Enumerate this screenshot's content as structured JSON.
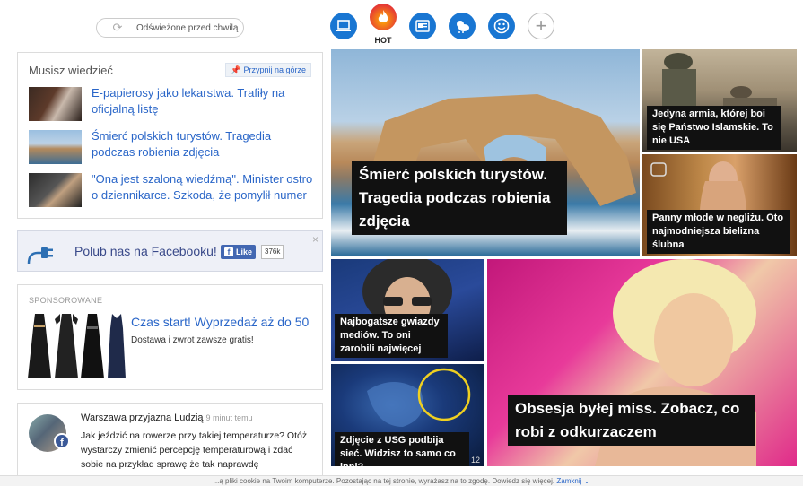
{
  "refresh": {
    "label": "Odświeżone przed chwilą",
    "icon": "refresh-icon"
  },
  "topnav": [
    {
      "id": "computer",
      "icon": "laptop-icon",
      "label": ""
    },
    {
      "id": "hot",
      "icon": "flame-icon",
      "label": "HOT"
    },
    {
      "id": "news",
      "icon": "news-icon",
      "label": ""
    },
    {
      "id": "weather",
      "icon": "weather-icon",
      "label": ""
    },
    {
      "id": "fun",
      "icon": "smiley-icon",
      "label": ""
    },
    {
      "id": "add",
      "icon": "plus-icon",
      "label": ""
    }
  ],
  "must_know": {
    "title": "Musisz wiedzieć",
    "pin_label": "Przypnij na górze",
    "items": [
      {
        "text": "E-papierosy jako lekarstwa. Trafiły na oficjalną listę"
      },
      {
        "text": "Śmierć polskich turystów. Tragedia podczas robienia zdjęcia"
      },
      {
        "text": "\"Ona jest szaloną wiedźmą\". Minister ostro o dziennikarce. Szkoda, że pomylił numer"
      }
    ]
  },
  "facebook": {
    "text": "Polub nas na Facebooku!",
    "like_label": "Like",
    "count": "376k"
  },
  "sponsored": {
    "label": "SPONSOROWANE",
    "title": "Czas start! Wyprzedaż aż do 50",
    "subtitle": "Dostawa i zwrot zawsze gratis!"
  },
  "post": {
    "author": "Warszawa przyjazna Ludzią",
    "time": "9 minut temu",
    "body": "Jak jeździć na rowerze przy takiej temperaturze? Otóż wystarczy zmienić percepcję temperaturową i zdać sobie na przykład sprawę że tak naprawdę"
  },
  "tiles": {
    "main": "Śmierć polskich turystów. Tragedia podczas robienia zdjęcia",
    "army": "Jedyna armia, której boi się Państwo Islamskie. To nie USA",
    "bride": "Panny młode w negliżu. Oto najmodniejsza bielizna ślubna",
    "rich": "Najbogatsze gwiazdy mediów. To oni zarobili najwięcej",
    "usg": "Zdjęcie z USG podbija sieć. Widzisz to samo co inni?",
    "usg_count": "12",
    "miss": "Obsesja byłej miss. Zobacz, co robi z odkurzaczem"
  },
  "cookie": {
    "text": "...ą pliki cookie na Twoim komputerze. Pozostając na tej stronie, wyrażasz na to zgodę. Dowiedz się więcej.",
    "close_label": "Zamknij"
  }
}
